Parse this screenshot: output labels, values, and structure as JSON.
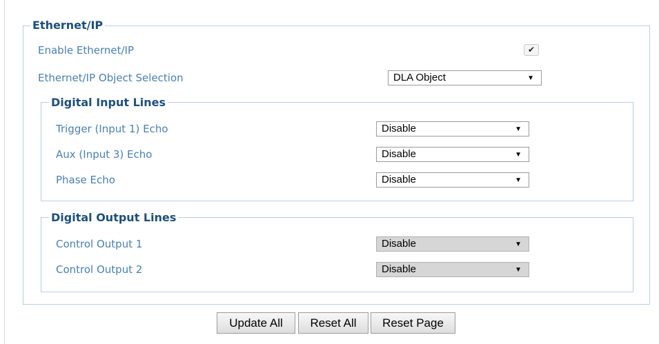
{
  "ethernet_ip": {
    "legend": "Ethernet/IP",
    "enable_label": "Enable Ethernet/IP",
    "enable_checked": true,
    "enable_check_glyph": "✔",
    "object_selection_label": "Ethernet/IP Object Selection",
    "object_selection_value": "DLA Object"
  },
  "digital_input_lines": {
    "legend": "Digital Input Lines",
    "rows": [
      {
        "label": "Trigger (Input 1) Echo",
        "value": "Disable"
      },
      {
        "label": "Aux (Input 3) Echo",
        "value": "Disable"
      },
      {
        "label": "Phase Echo",
        "value": "Disable"
      }
    ]
  },
  "digital_output_lines": {
    "legend": "Digital Output Lines",
    "rows": [
      {
        "label": "Control Output 1",
        "value": "Disable",
        "disabled": true
      },
      {
        "label": "Control Output 2",
        "value": "Disable",
        "disabled": true
      }
    ]
  },
  "dropdown_arrow": "▼",
  "buttons": {
    "update_all": "Update All",
    "reset_all": "Reset All",
    "reset_page": "Reset Page"
  },
  "colors": {
    "legend_text": "#1d4f7a",
    "label_text": "#4a7fb0",
    "group_border": "#b9cde0",
    "disabled_select": "#d6d6d6"
  }
}
